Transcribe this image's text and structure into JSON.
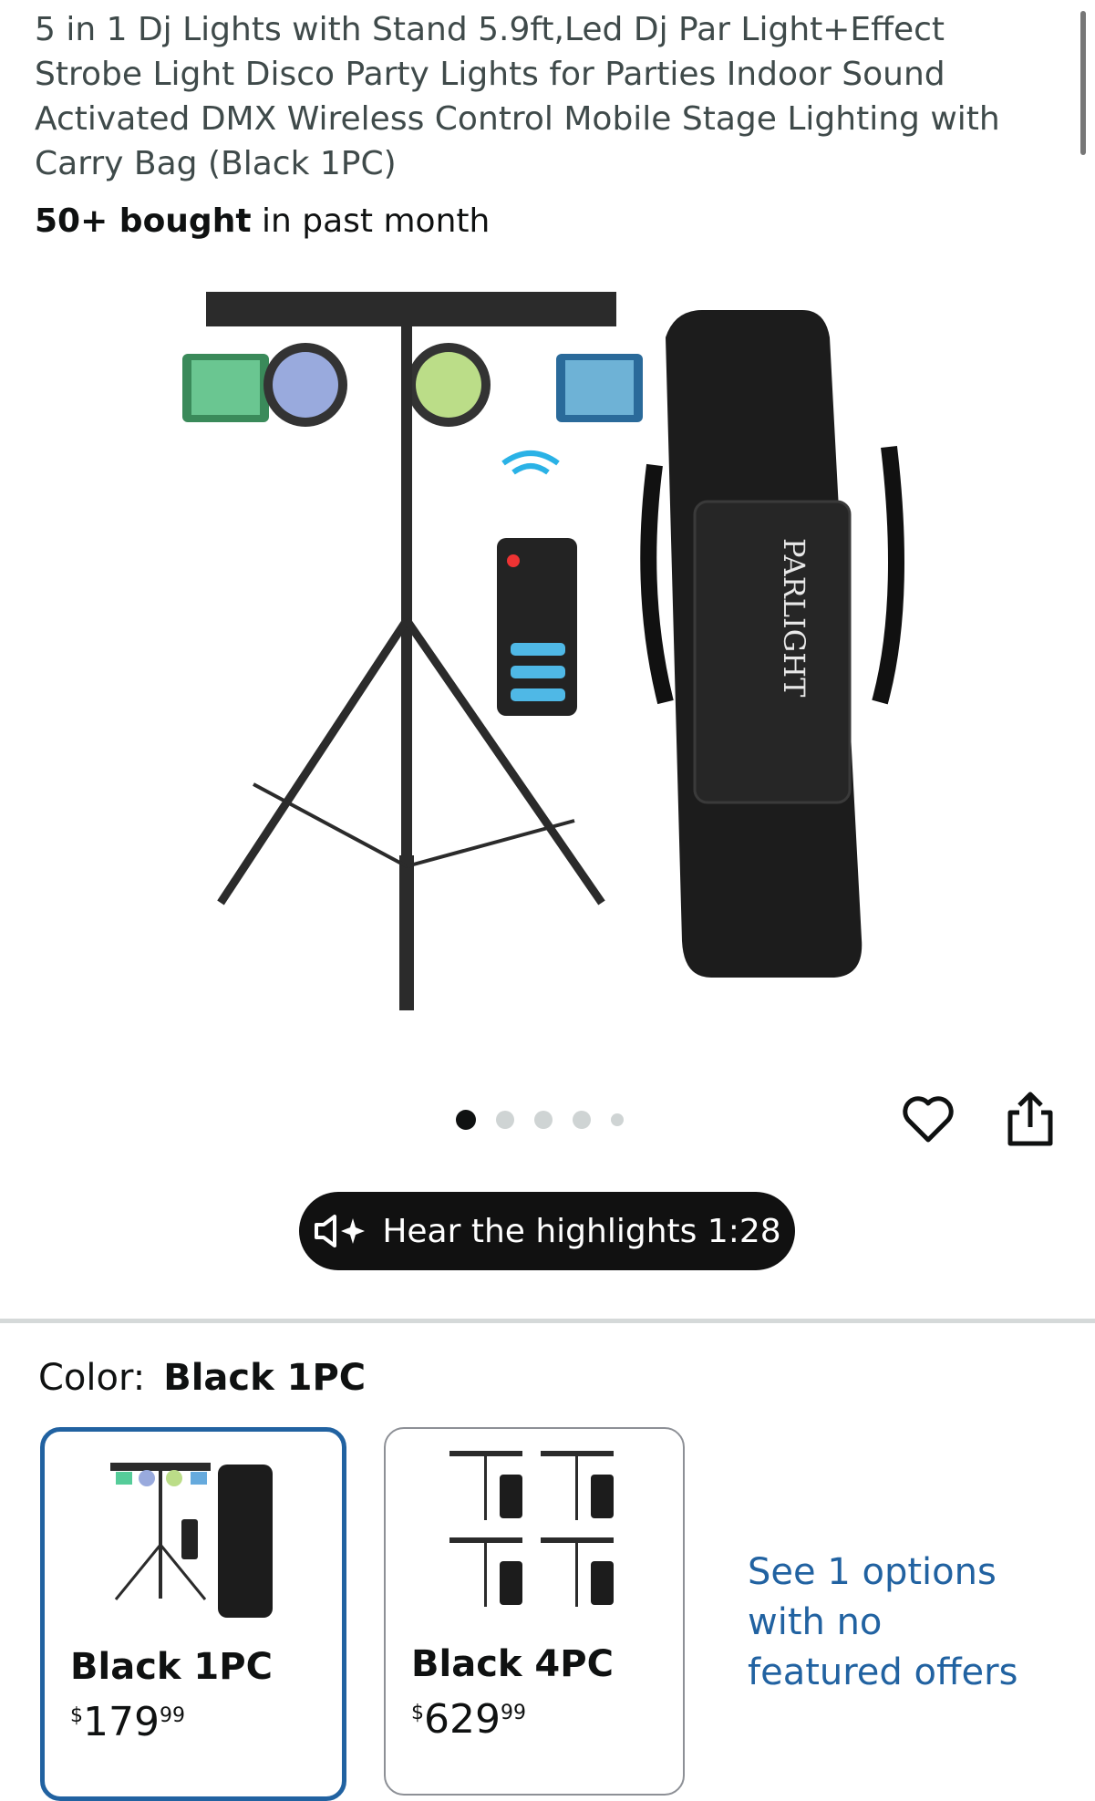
{
  "product": {
    "title": "5 in 1 Dj Lights with Stand 5.9ft,Led Dj Par Light+Effect Strobe Light Disco Party Lights for Parties Indoor Sound Activated DMX Wireless Control Mobile Stage Lighting with Carry Bag (Black 1PC)",
    "bought_bold": "50+ bought",
    "bought_rest": " in past month",
    "bag_text": "PARLIGHT"
  },
  "gallery": {
    "dot_count": 5,
    "active_index": 0
  },
  "actions": {
    "favorite_icon": "heart-icon",
    "share_icon": "share-icon"
  },
  "audio": {
    "label": "Hear the highlights 1:28",
    "icon": "speaker-sparkle-icon"
  },
  "variation": {
    "label": "Color:",
    "selected": "Black 1PC",
    "options": [
      {
        "name": "Black 1PC",
        "price_symbol": "$",
        "price_whole": "179",
        "price_fraction": "99",
        "selected": true
      },
      {
        "name": "Black 4PC",
        "price_symbol": "$",
        "price_whole": "629",
        "price_fraction": "99",
        "selected": false
      }
    ],
    "see_more": "See 1 options with no featured offers"
  },
  "colors": {
    "link": "#2162a1",
    "selected_border": "#2162a1",
    "pill_bg": "#111111"
  }
}
